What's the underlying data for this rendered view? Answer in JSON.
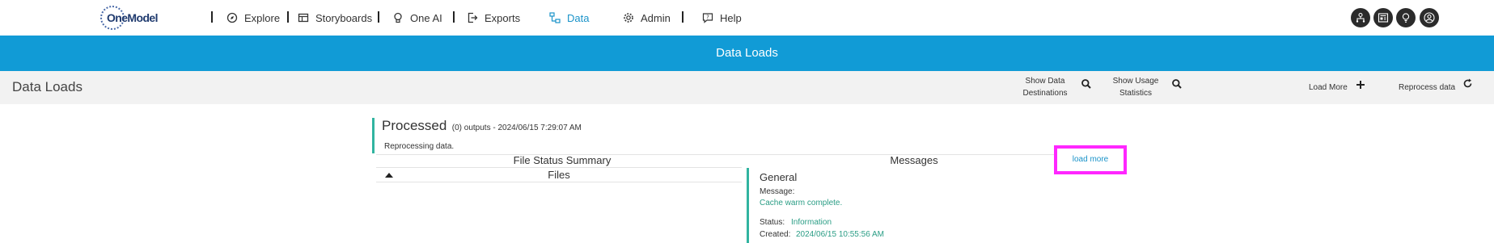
{
  "nav": {
    "logo_text": "OneModel",
    "items": [
      {
        "label": "Explore",
        "icon": "compass-icon"
      },
      {
        "label": "Storyboards",
        "icon": "storyboard-icon"
      },
      {
        "label": "One AI",
        "icon": "lightbulb-icon"
      },
      {
        "label": "Exports",
        "icon": "export-icon"
      },
      {
        "label": "Data",
        "icon": "data-icon",
        "active": true
      },
      {
        "label": "Admin",
        "icon": "gear-icon"
      },
      {
        "label": "Help",
        "icon": "help-icon"
      }
    ],
    "right_icons": [
      "org-chart-icon",
      "news-icon",
      "idea-icon",
      "user-icon"
    ],
    "active_color": "#1a93c9"
  },
  "banner": {
    "title": "Data Loads",
    "color": "#119bd6"
  },
  "toolbar": {
    "title": "Data Loads",
    "show_destinations": "Show Data Destinations",
    "show_destinations_l1": "Show Data",
    "show_destinations_l2": "Destinations",
    "show_usage_l1": "Show Usage",
    "show_usage_l2": "Statistics",
    "load_more": "Load More",
    "reprocess": "Reprocess data"
  },
  "status": {
    "title": "Processed",
    "meta": "(0) outputs - 2024/06/15 7:29:07 AM",
    "note": "Reprocessing data.",
    "accent": "#31b4a0"
  },
  "file_summary": {
    "header": "File Status Summary",
    "files_header": "Files"
  },
  "messages": {
    "header": "Messages",
    "load_more": "load more",
    "items": [
      {
        "title": "General",
        "message_label": "Message:",
        "message": "Cache warm complete.",
        "status_label": "Status:",
        "status": "Information",
        "created_label": "Created:",
        "created": "2024/06/15 10:55:56 AM"
      }
    ]
  }
}
